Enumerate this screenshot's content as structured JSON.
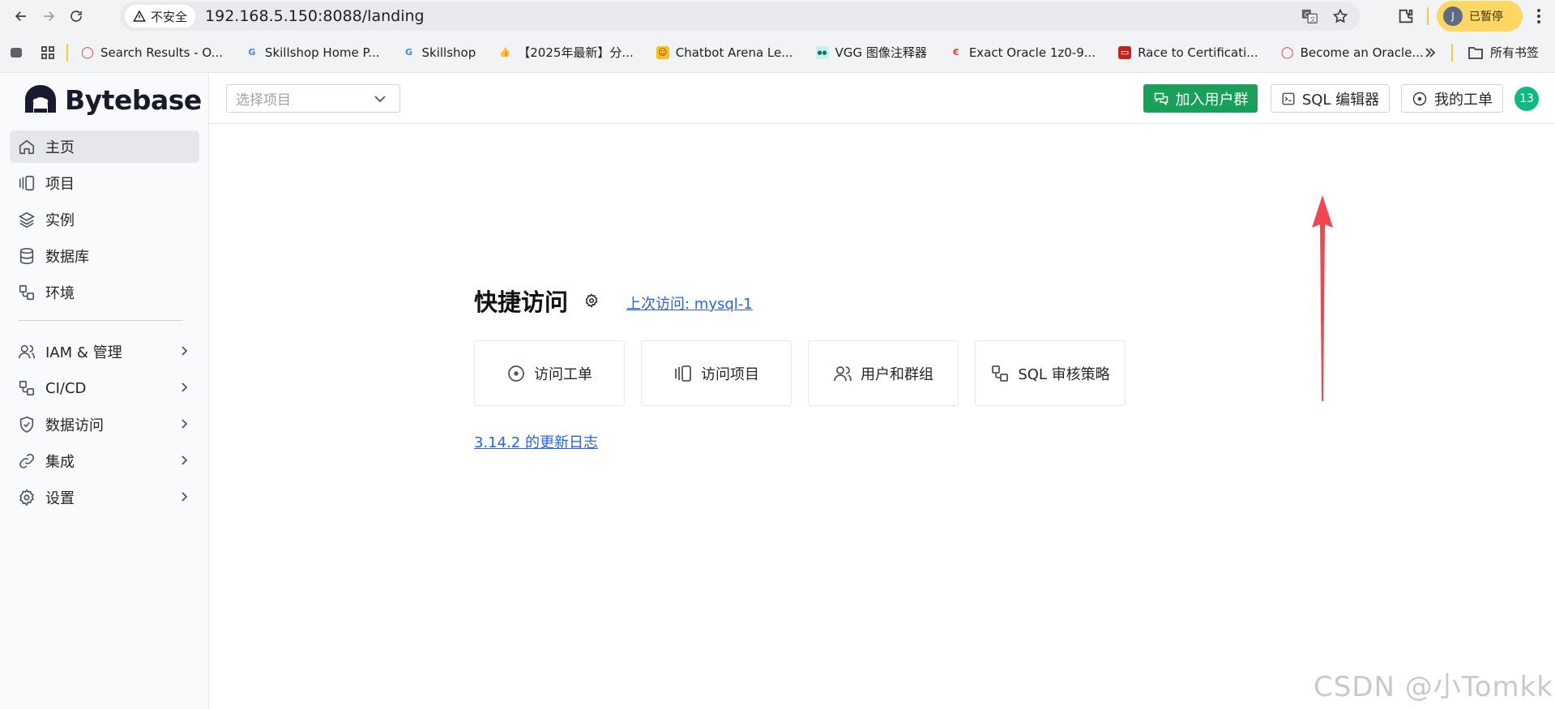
{
  "browser": {
    "security_label": "不安全",
    "url": "192.168.5.150:8088/landing",
    "profile_initial": "J",
    "profile_status": "已暂停"
  },
  "bookmarks": {
    "items": [
      {
        "label": "Search Results - O...",
        "icon": "oracle-icon"
      },
      {
        "label": "Skillshop Home P...",
        "icon": "google-icon"
      },
      {
        "label": "Skillshop",
        "icon": "google-icon"
      },
      {
        "label": "【2025年最新】分...",
        "icon": "thumbs-up-icon"
      },
      {
        "label": "Chatbot Arena Le...",
        "icon": "hugging-face-icon"
      },
      {
        "label": "VGG 图像注释器",
        "icon": "vgg-icon"
      },
      {
        "label": "Exact Oracle 1z0-9...",
        "icon": "exact-icon"
      },
      {
        "label": "Race to Certificati...",
        "icon": "oracle-square-icon"
      },
      {
        "label": "Become an Oracle...",
        "icon": "oracle-icon"
      }
    ],
    "all_bookmarks_label": "所有书签"
  },
  "sidebar": {
    "brand": "Bytebase",
    "items": [
      {
        "label": "主页",
        "icon": "home-icon",
        "active": true
      },
      {
        "label": "项目",
        "icon": "project-icon"
      },
      {
        "label": "实例",
        "icon": "layers-icon"
      },
      {
        "label": "数据库",
        "icon": "database-icon"
      },
      {
        "label": "环境",
        "icon": "environment-icon"
      }
    ],
    "groups": [
      {
        "label": "IAM & 管理",
        "icon": "users-icon"
      },
      {
        "label": "CI/CD",
        "icon": "workflow-icon"
      },
      {
        "label": "数据访问",
        "icon": "shield-check-icon"
      },
      {
        "label": "集成",
        "icon": "link-icon"
      },
      {
        "label": "设置",
        "icon": "gear-icon"
      }
    ]
  },
  "topbar": {
    "project_placeholder": "选择项目",
    "join_group_label": "加入用户群",
    "sql_editor_label": "SQL 编辑器",
    "my_issues_label": "我的工单",
    "notification_count": "13"
  },
  "main": {
    "quick_access_title": "快捷访问",
    "last_visit": "上次访问: mysql-1",
    "cards": [
      {
        "label": "访问工单",
        "icon": "circle-dot-icon"
      },
      {
        "label": "访问项目",
        "icon": "project-icon"
      },
      {
        "label": "用户和群组",
        "icon": "users-icon"
      },
      {
        "label": "SQL 审核策略",
        "icon": "workflow-icon"
      }
    ],
    "changelog": "3.14.2 的更新日志"
  },
  "watermark": "CSDN @小Tomkk",
  "colors": {
    "accent_green": "#18a058",
    "link_blue": "#2563eb",
    "annotation_arrow": "#f0474f"
  }
}
